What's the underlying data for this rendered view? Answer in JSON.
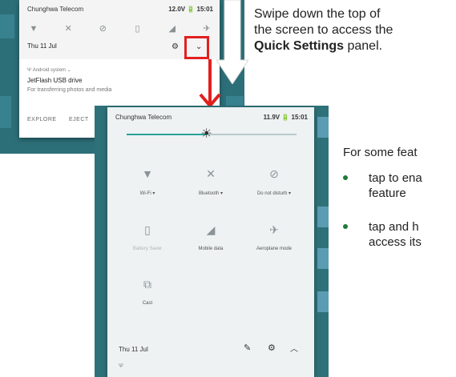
{
  "shade_top": {
    "carrier": "Chunghwa Telecom",
    "status_right": "12.0V 🔋 15:01",
    "icons": [
      "wifi-icon",
      "bluetooth-off-icon",
      "dnd-icon",
      "battery-icon",
      "mobile-data-icon",
      "airplane-icon"
    ],
    "date": "Thu 11 Jul",
    "notification": {
      "app": "Android system",
      "title": "JetFlash USB drive",
      "subtitle": "For transferring photos and media",
      "action_explore": "EXPLORE",
      "action_eject": "EJECT"
    }
  },
  "instruction": {
    "line1": "Swipe down the top of",
    "line2": "the screen to access the",
    "bold": "Quick Settings",
    "after_bold": " panel."
  },
  "side_text": {
    "intro": "For some feat",
    "bullet1_line1": "tap to ena",
    "bullet1_line2": "feature",
    "bullet2_line1": "tap and h",
    "bullet2_line2": "access its",
    "bullet_color": "#1f7a3a"
  },
  "quick_settings": {
    "carrier": "Chunghwa Telecom",
    "status_right": "11.9V 🔋 15:01",
    "brightness_level": 0.47,
    "tiles": [
      {
        "name": "Wi-Fi ▾",
        "icon": "wifi-icon"
      },
      {
        "name": "Bluetooth ▾",
        "icon": "bluetooth-off-icon"
      },
      {
        "name": "Do not disturb ▾",
        "icon": "dnd-icon"
      },
      {
        "name": "Battery Saver",
        "icon": "battery-icon"
      },
      {
        "name": "Mobile data",
        "icon": "mobile-data-icon"
      },
      {
        "name": "Aeroplane mode",
        "icon": "airplane-icon"
      },
      {
        "name": "Cast",
        "icon": "cast-icon"
      }
    ],
    "date": "Thu 11 Jul"
  },
  "colors": {
    "highlight_red": "#e1201f",
    "teal_accent": "#2aa198"
  }
}
